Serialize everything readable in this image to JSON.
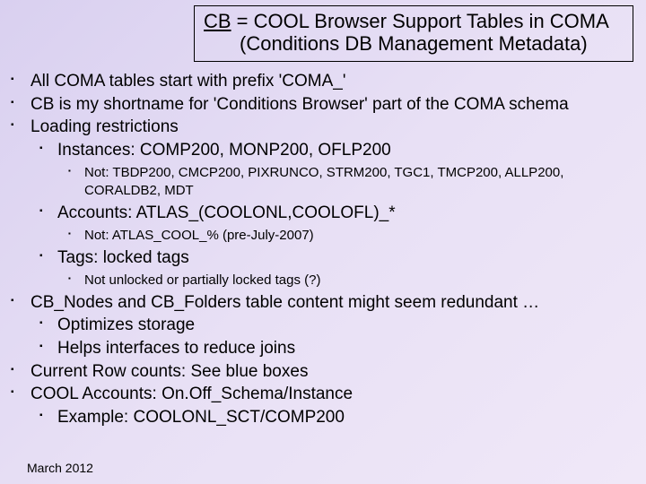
{
  "title": {
    "line1_pre": "CB",
    "line1_rest": " = COOL Browser Support Tables in COMA",
    "line2": "(Conditions DB Management Metadata)"
  },
  "bullets": {
    "b1": "All COMA tables start with prefix 'COMA_'",
    "b2": "CB is my shortname for 'Conditions Browser' part of the COMA schema",
    "b3": "Loading restrictions",
    "b3a": "Instances: COMP200, MONP200, OFLP200",
    "b3a1": "Not: TBDP200, CMCP200, PIXRUNCO, STRM200, TGC1, TMCP200, ALLP200, CORALDB2, MDT",
    "b3b": "Accounts: ATLAS_(COOLONL,COOLOFL)_*",
    "b3b1": "Not: ATLAS_COOL_% (pre-July-2007)",
    "b3c": "Tags: locked tags",
    "b3c1": "Not unlocked or partially locked tags (?)",
    "b4": "CB_Nodes and CB_Folders table content might seem redundant …",
    "b4a": "Optimizes storage",
    "b4b": "Helps interfaces to reduce joins",
    "b5": "Current Row counts: See blue boxes",
    "b6": "COOL Accounts: On.Off_Schema/Instance",
    "b6a": "Example: COOLONL_SCT/COMP200"
  },
  "footer": "March  2012"
}
